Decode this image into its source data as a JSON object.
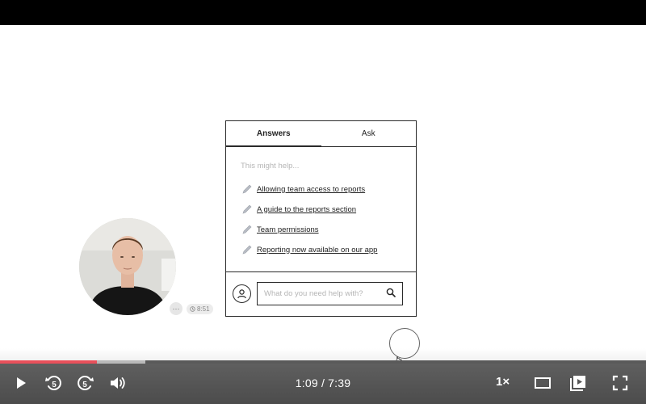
{
  "widget": {
    "tabs": [
      {
        "label": "Answers",
        "active": true
      },
      {
        "label": "Ask",
        "active": false
      }
    ],
    "hint": "This might help...",
    "articles": [
      {
        "label": "Allowing team access to reports",
        "icon": "pencil-icon"
      },
      {
        "label": "A guide to the reports section",
        "icon": "pencil-icon"
      },
      {
        "label": "Team permissions",
        "icon": "pencil-icon"
      },
      {
        "label": "Reporting now available on our app",
        "icon": "pencil-icon"
      }
    ],
    "search": {
      "placeholder": "What do you need help with?",
      "value": ""
    }
  },
  "presenter": {
    "menu_label": "···",
    "duration": "8:51"
  },
  "player": {
    "progress_fraction": 0.15,
    "buffered_fraction": 0.225,
    "current_time": "1:09",
    "separator": "/",
    "total_time": "7:39",
    "rewind_seconds": "5",
    "forward_seconds": "5",
    "speed": "1×"
  },
  "colors": {
    "progress_played": "#e8505b",
    "control_bar": "#555555"
  }
}
